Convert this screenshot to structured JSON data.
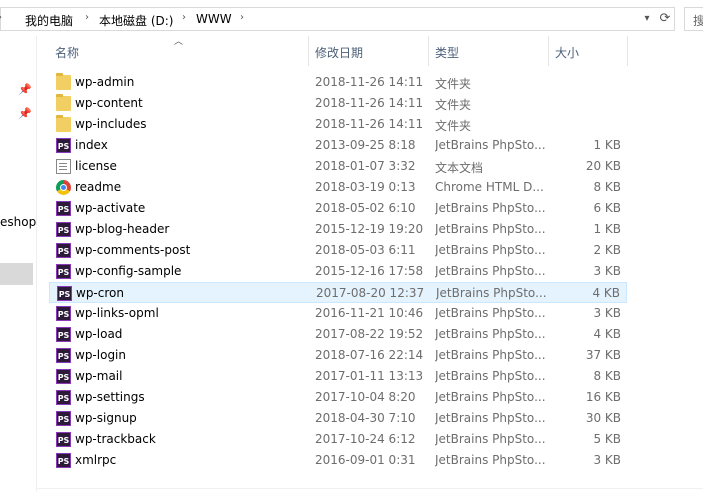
{
  "address_bar": {
    "segments": [
      "我的电脑",
      "本地磁盘 (D:)",
      "WWW"
    ]
  },
  "search": {
    "placeholder": "搜"
  },
  "nav": {
    "partial_label": "eshop"
  },
  "columns": {
    "name": "名称",
    "date": "修改日期",
    "type": "类型",
    "size": "大小"
  },
  "files": [
    {
      "name": "wp-admin",
      "date": "2018-11-26  14:11",
      "type": "文件夹",
      "size": "",
      "icon": "folder-icon"
    },
    {
      "name": "wp-content",
      "date": "2018-11-26  14:11",
      "type": "文件夹",
      "size": "",
      "icon": "folder-icon"
    },
    {
      "name": "wp-includes",
      "date": "2018-11-26  14:11",
      "type": "文件夹",
      "size": "",
      "icon": "folder-icon"
    },
    {
      "name": "index",
      "date": "2013-09-25  8:18",
      "type": "JetBrains PhpSto...",
      "size": "1 KB",
      "icon": "phpstorm-icon"
    },
    {
      "name": "license",
      "date": "2018-01-07  3:32",
      "type": "文本文档",
      "size": "20 KB",
      "icon": "text-file-icon"
    },
    {
      "name": "readme",
      "date": "2018-03-19  0:13",
      "type": "Chrome HTML D...",
      "size": "8 KB",
      "icon": "chrome-icon"
    },
    {
      "name": "wp-activate",
      "date": "2018-05-02  6:10",
      "type": "JetBrains PhpSto...",
      "size": "6 KB",
      "icon": "phpstorm-icon"
    },
    {
      "name": "wp-blog-header",
      "date": "2015-12-19  19:20",
      "type": "JetBrains PhpSto...",
      "size": "1 KB",
      "icon": "phpstorm-icon"
    },
    {
      "name": "wp-comments-post",
      "date": "2018-05-03  6:11",
      "type": "JetBrains PhpSto...",
      "size": "2 KB",
      "icon": "phpstorm-icon"
    },
    {
      "name": "wp-config-sample",
      "date": "2015-12-16  17:58",
      "type": "JetBrains PhpSto...",
      "size": "3 KB",
      "icon": "phpstorm-icon"
    },
    {
      "name": "wp-cron",
      "date": "2017-08-20  12:37",
      "type": "JetBrains PhpSto...",
      "size": "4 KB",
      "icon": "phpstorm-icon",
      "highlighted": true
    },
    {
      "name": "wp-links-opml",
      "date": "2016-11-21  10:46",
      "type": "JetBrains PhpSto...",
      "size": "3 KB",
      "icon": "phpstorm-icon"
    },
    {
      "name": "wp-load",
      "date": "2017-08-22  19:52",
      "type": "JetBrains PhpSto...",
      "size": "4 KB",
      "icon": "phpstorm-icon"
    },
    {
      "name": "wp-login",
      "date": "2018-07-16  22:14",
      "type": "JetBrains PhpSto...",
      "size": "37 KB",
      "icon": "phpstorm-icon"
    },
    {
      "name": "wp-mail",
      "date": "2017-01-11  13:13",
      "type": "JetBrains PhpSto...",
      "size": "8 KB",
      "icon": "phpstorm-icon"
    },
    {
      "name": "wp-settings",
      "date": "2017-10-04  8:20",
      "type": "JetBrains PhpSto...",
      "size": "16 KB",
      "icon": "phpstorm-icon"
    },
    {
      "name": "wp-signup",
      "date": "2018-04-30  7:10",
      "type": "JetBrains PhpSto...",
      "size": "30 KB",
      "icon": "phpstorm-icon"
    },
    {
      "name": "wp-trackback",
      "date": "2017-10-24  6:12",
      "type": "JetBrains PhpSto...",
      "size": "5 KB",
      "icon": "phpstorm-icon"
    },
    {
      "name": "xmlrpc",
      "date": "2016-09-01  0:31",
      "type": "JetBrains PhpSto...",
      "size": "3 KB",
      "icon": "phpstorm-icon"
    }
  ],
  "icons": {
    "phpstorm_label": "PS"
  },
  "colors": {
    "header_text": "#4c607a",
    "highlight_bg": "#e5f3ff",
    "detail_text": "#6d6d6d",
    "folder": "#f2cf62"
  }
}
